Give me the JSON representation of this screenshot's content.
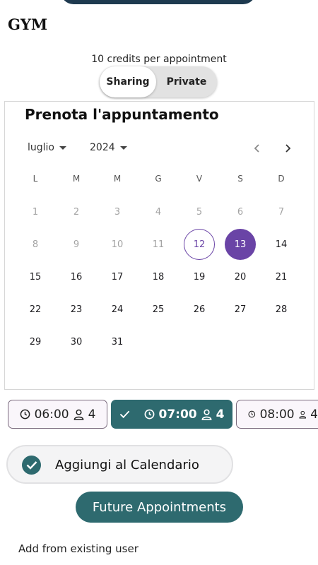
{
  "header": {
    "title": "GYM"
  },
  "booking": {
    "credits_text": "10 credits per appointment",
    "mode_options": [
      "Sharing",
      "Private"
    ],
    "selected_mode": "Sharing"
  },
  "calendar": {
    "title": "Prenota l'appuntamento",
    "month": "luglio",
    "year": "2024",
    "weekdays": [
      "L",
      "M",
      "M",
      "G",
      "V",
      "S",
      "D"
    ],
    "days": [
      "1",
      "2",
      "3",
      "4",
      "5",
      "6",
      "7",
      "8",
      "9",
      "10",
      "11",
      "12",
      "13",
      "14",
      "15",
      "16",
      "17",
      "18",
      "19",
      "20",
      "21",
      "22",
      "23",
      "24",
      "25",
      "26",
      "27",
      "28",
      "29",
      "30",
      "31"
    ],
    "today": "12",
    "selected_day": "13",
    "accent_color": "#6a44a6"
  },
  "time_slots": [
    {
      "time": "06:00",
      "count": "4",
      "selected": false
    },
    {
      "time": "07:00",
      "count": "4",
      "selected": true
    },
    {
      "time": "08:00",
      "count": "4",
      "selected": false
    }
  ],
  "add_to_calendar": {
    "label": "Aggiungi al Calendario",
    "checked": true
  },
  "future_button": {
    "label": "Future Appointments"
  },
  "existing_user": {
    "label": "Add from existing user"
  },
  "colors": {
    "primary": "#2e6a6f",
    "header_bar": "#1e3a4f"
  }
}
